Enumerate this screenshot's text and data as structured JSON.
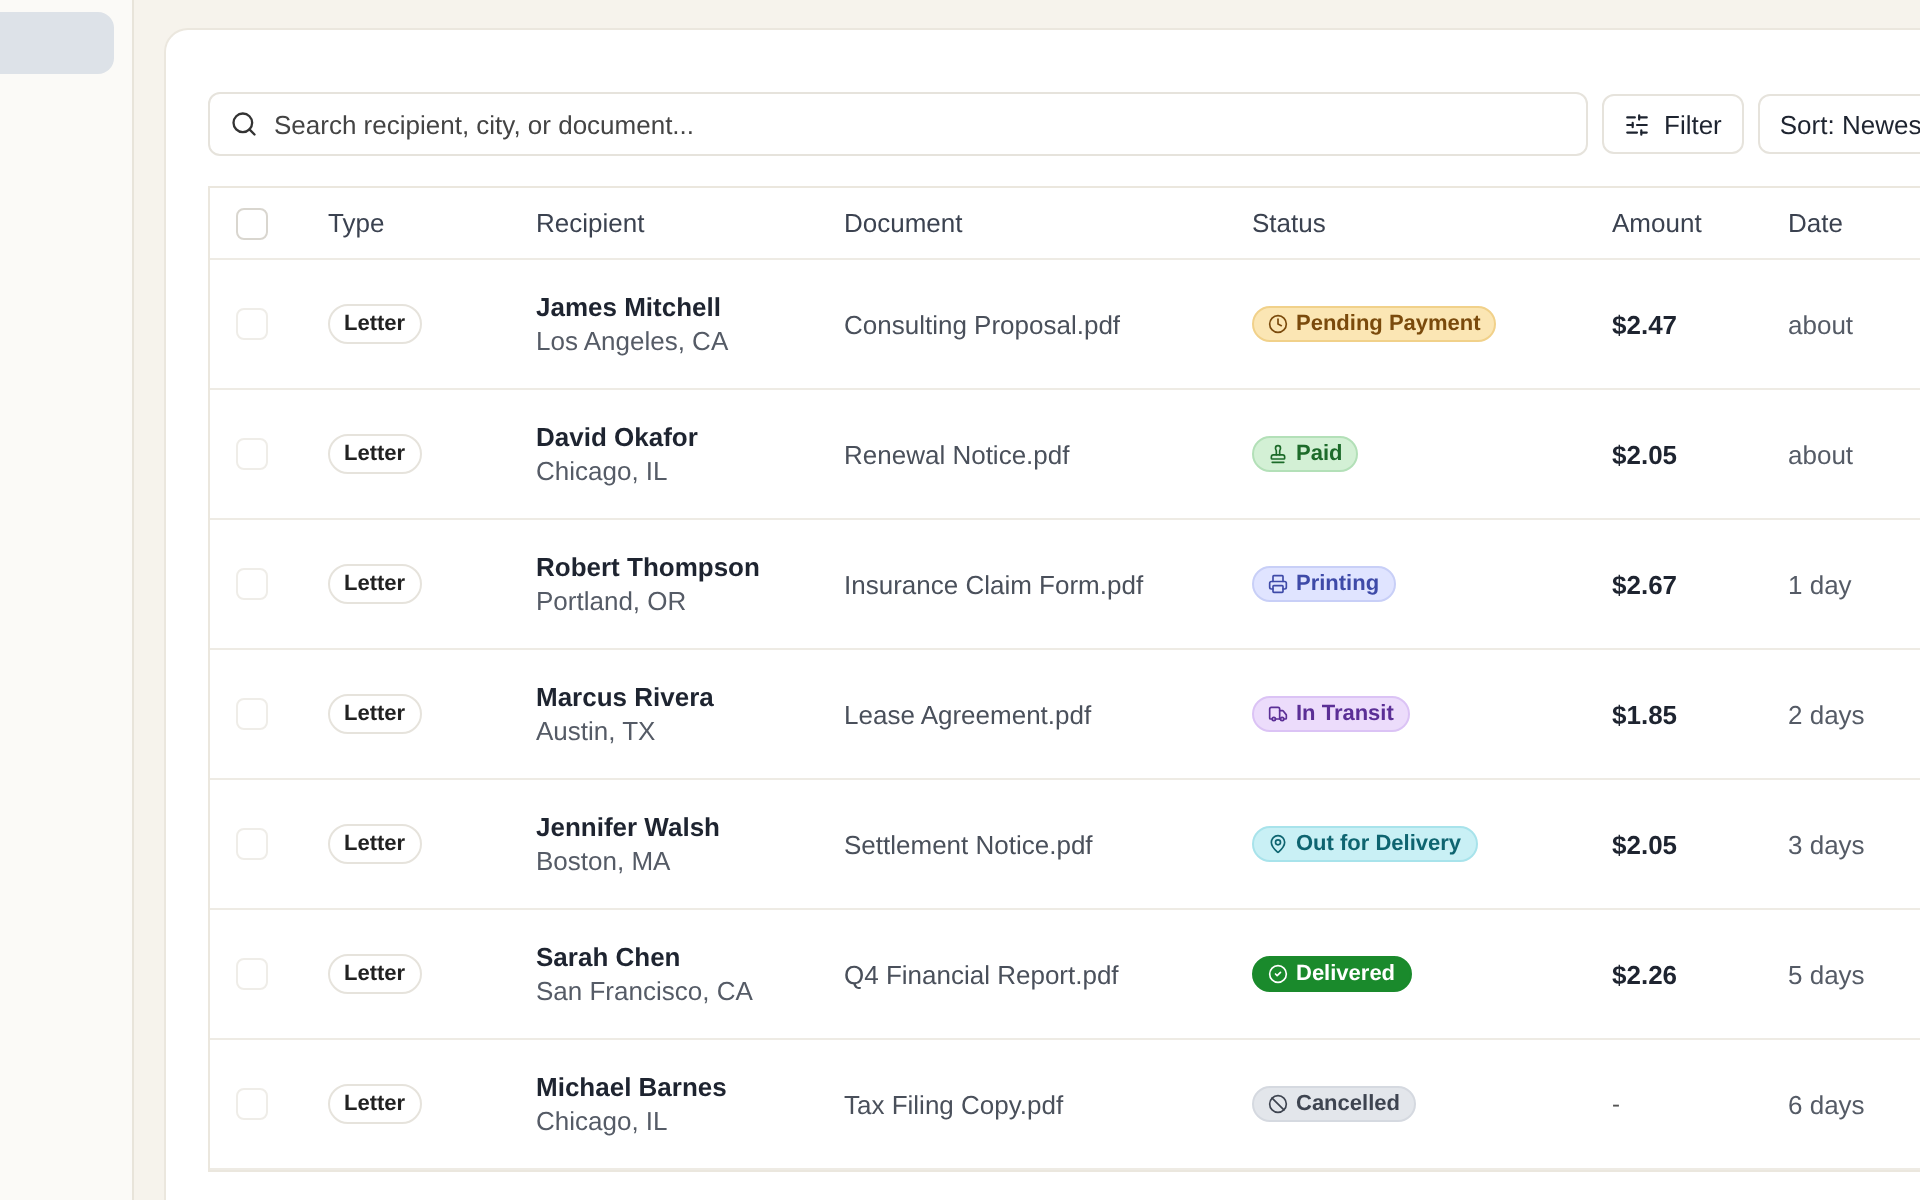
{
  "search": {
    "placeholder": "Search recipient, city, or document..."
  },
  "filter_button": "Filter",
  "sort_button": "Sort: Newes",
  "table": {
    "select_all": {
      "checked": false
    },
    "columns": [
      "Type",
      "Recipient",
      "Document",
      "Status",
      "Amount",
      "Date"
    ],
    "rows": [
      {
        "checked": false,
        "type": "Letter",
        "name": "James Mitchell",
        "city": "Los Angeles, CA",
        "document": "Consulting Proposal.pdf",
        "status": {
          "kind": "pending",
          "label": "Pending Payment"
        },
        "amount": "$2.47",
        "date": "about"
      },
      {
        "checked": false,
        "type": "Letter",
        "name": "David Okafor",
        "city": "Chicago, IL",
        "document": "Renewal Notice.pdf",
        "status": {
          "kind": "paid",
          "label": "Paid"
        },
        "amount": "$2.05",
        "date": "about"
      },
      {
        "checked": false,
        "type": "Letter",
        "name": "Robert Thompson",
        "city": "Portland, OR",
        "document": "Insurance Claim Form.pdf",
        "status": {
          "kind": "printing",
          "label": "Printing"
        },
        "amount": "$2.67",
        "date": "1 day"
      },
      {
        "checked": false,
        "type": "Letter",
        "name": "Marcus Rivera",
        "city": "Austin, TX",
        "document": "Lease Agreement.pdf",
        "status": {
          "kind": "transit",
          "label": "In Transit"
        },
        "amount": "$1.85",
        "date": "2 days"
      },
      {
        "checked": false,
        "type": "Letter",
        "name": "Jennifer Walsh",
        "city": "Boston, MA",
        "document": "Settlement Notice.pdf",
        "status": {
          "kind": "delivery",
          "label": "Out for Delivery"
        },
        "amount": "$2.05",
        "date": "3 days"
      },
      {
        "checked": false,
        "type": "Letter",
        "name": "Sarah Chen",
        "city": "San Francisco, CA",
        "document": "Q4 Financial Report.pdf",
        "status": {
          "kind": "delivered",
          "label": "Delivered"
        },
        "amount": "$2.26",
        "date": "5 days"
      },
      {
        "checked": false,
        "type": "Letter",
        "name": "Michael Barnes",
        "city": "Chicago, IL",
        "document": "Tax Filing Copy.pdf",
        "status": {
          "kind": "cancelled",
          "label": "Cancelled"
        },
        "amount": "-",
        "date": "6 days"
      }
    ]
  }
}
